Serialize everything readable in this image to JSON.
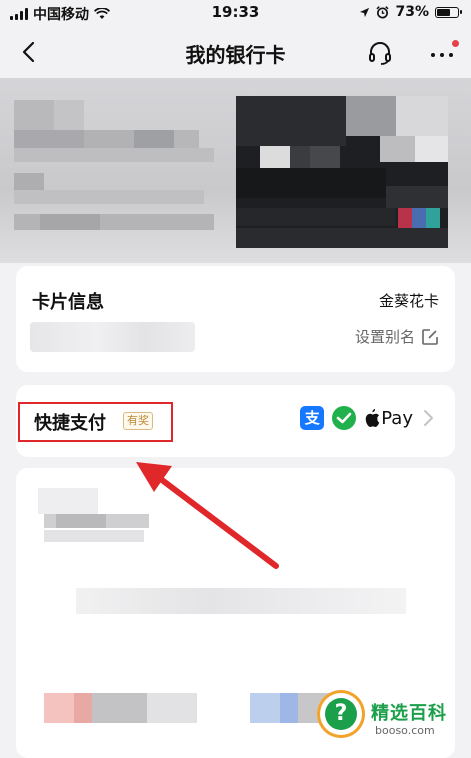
{
  "status_bar": {
    "carrier": "中国移动",
    "time": "19:33",
    "battery": "73%",
    "battery_level": 0.73
  },
  "nav": {
    "title": "我的银行卡"
  },
  "card_info": {
    "title": "卡片信息",
    "card_type": "金葵花卡",
    "set_alias": "设置别名"
  },
  "quick_pay": {
    "label": "快捷支付",
    "badge": "有奖",
    "alipay_glyph": "支",
    "applepay_text": "Pay"
  },
  "watermark": {
    "name": "精选百科",
    "site": "booso.com"
  },
  "colors": {
    "accent_red": "#e0272a",
    "alipay_blue": "#1677ff",
    "wechat_green": "#21b14c"
  }
}
